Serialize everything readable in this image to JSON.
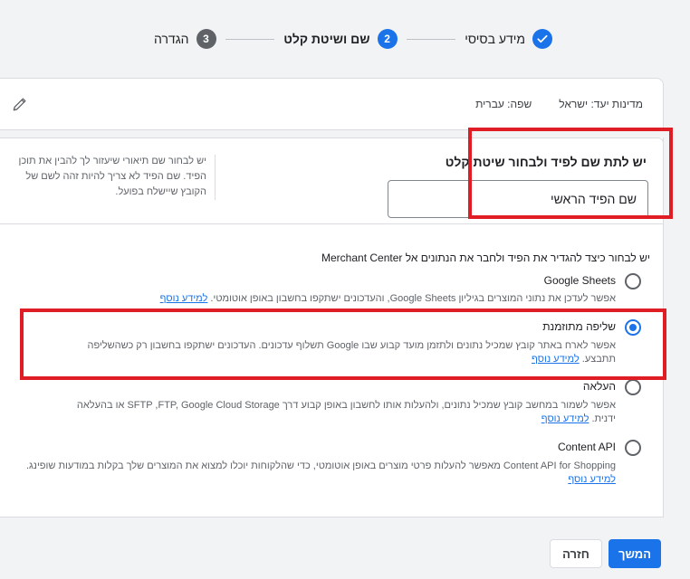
{
  "stepper": {
    "steps": [
      {
        "label": "מידע בסיסי",
        "state": "done",
        "number": ""
      },
      {
        "label": "שם ושיטת קלט",
        "state": "active",
        "number": "2"
      },
      {
        "label": "הגדרה",
        "state": "todo",
        "number": "3"
      }
    ]
  },
  "summary": {
    "country": "מדינות יעד: ישראל",
    "language": "שפה: עברית"
  },
  "feed_name": {
    "title": "יש לתת שם לפיד ולבחור שיטת קלט",
    "value": "שם הפיד הראשי",
    "help": "יש לבחור שם תיאורי שיעזור לך להבין את תוכן הפיד. שם הפיד לא צריך להיות זהה לשם של הקובץ שיישלח בפועל."
  },
  "method_question": "יש לבחור כיצד להגדיר את הפיד ולחבר את הנתונים אל Merchant Center",
  "learn_more": "למידע נוסף",
  "options": [
    {
      "title": "Google Sheets",
      "desc": "אפשר לעדכן את נתוני המוצרים בגיליון Google Sheets, והעדכונים ישתקפו בחשבון באופן אוטומטי.",
      "checked": false
    },
    {
      "title": "שליפה מתוזמנת",
      "desc": "אפשר לארח באתר קובץ שמכיל נתונים ולתזמן מועד קבוע שבו Google תשלוף עדכונים. העדכונים ישתקפו בחשבון רק כשהשליפה תתבצע.",
      "checked": true
    },
    {
      "title": "העלאה",
      "desc": "אפשר לשמור במחשב קובץ שמכיל נתונים, ולהעלות אותו לחשבון באופן קבוע דרך SFTP ,FTP, Google Cloud Storage או בהעלאה ידנית.",
      "checked": false
    },
    {
      "title": "Content API",
      "desc": "Content API for Shopping מאפשר להעלות פרטי מוצרים באופן אוטומטי, כדי שהלקוחות יוכלו למצוא את המוצרים שלך בקלות במודעות שופינג.",
      "checked": false
    }
  ],
  "buttons": {
    "continue": "המשך",
    "back": "חזרה"
  },
  "colors": {
    "accent": "#1a73e8",
    "highlight": "#e01c24"
  }
}
